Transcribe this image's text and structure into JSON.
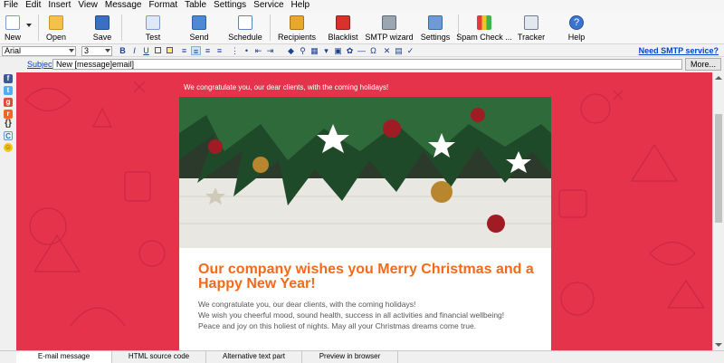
{
  "menu": [
    "File",
    "Edit",
    "Insert",
    "View",
    "Message",
    "Format",
    "Table",
    "Settings",
    "Service",
    "Help"
  ],
  "toolbar": {
    "new": "New",
    "open": "Open",
    "save": "Save",
    "test": "Test",
    "send": "Send",
    "schedule": "Schedule",
    "recipients": "Recipients",
    "blacklist": "Blacklist",
    "smtp_wizard": "SMTP wizard",
    "settings": "Settings",
    "spam_check": "Spam Check ...",
    "tracker": "Tracker",
    "help": "Help"
  },
  "format": {
    "font": "Arial",
    "size": "3",
    "need_smtp": "Need SMTP service?"
  },
  "subject": {
    "label": "Subject:",
    "value": "New [message]email]",
    "more": "More..."
  },
  "email": {
    "top_greeting": "We congratulate you, our dear clients, with the coming holidays!",
    "headline": "Our company wishes you Merry Christmas and a Happy New Year!",
    "line1": "We congratulate you, our dear clients, with the coming holidays!",
    "line2": "We wish you cheerful mood, sound health, success in all activities and financial wellbeing!",
    "line3": "Peace and joy on this holiest of nights. May all your Christmas dreams come true."
  },
  "tabs": [
    "E-mail message",
    "HTML source code",
    "Alternative text part",
    "Preview in browser"
  ],
  "colors": {
    "background_red": "#e6334c",
    "headline_orange": "#f26a1a"
  }
}
